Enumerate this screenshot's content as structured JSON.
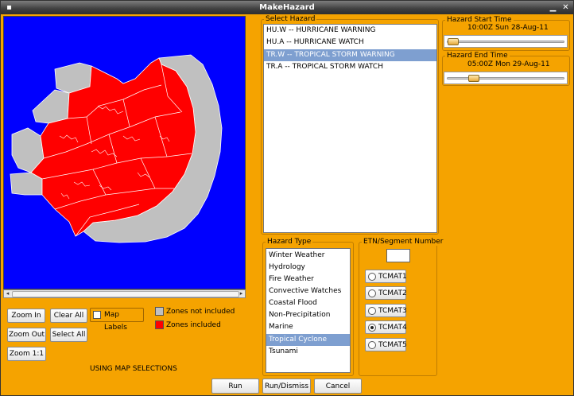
{
  "window": {
    "title": "MakeHazard"
  },
  "map": {
    "buttons": {
      "zoom_in": "Zoom In",
      "clear_all": "Clear All",
      "zoom_out": "Zoom Out",
      "select_all": "Select All",
      "zoom_1_1": "Zoom 1:1"
    },
    "map_labels": "Map Labels",
    "legend": {
      "not_included": "Zones not included",
      "included": "Zones included"
    },
    "status": "USING MAP SELECTIONS",
    "colors": {
      "water": "#0000ff",
      "included": "#ff0000",
      "not_included": "#c0c0c0"
    }
  },
  "select_hazard": {
    "title": "Select Hazard",
    "items": [
      "HU.W -- HURRICANE WARNING",
      "HU.A -- HURRICANE WATCH",
      "TR.W -- TROPICAL STORM WARNING",
      "TR.A -- TROPICAL STORM WATCH"
    ],
    "selected": "TR.W -- TROPICAL STORM WARNING"
  },
  "start_time": {
    "title": "Hazard Start Time",
    "value": "10:00Z Sun 28-Aug-11"
  },
  "end_time": {
    "title": "Hazard End Time",
    "value": "05:00Z Mon 29-Aug-11"
  },
  "hazard_type": {
    "title": "Hazard Type",
    "items": [
      "Winter Weather",
      "Hydrology",
      "Fire Weather",
      "Convective Watches",
      "Coastal Flood",
      "Non-Precipitation",
      "Marine",
      "Tropical Cyclone",
      "Tsunami"
    ],
    "selected": "Tropical Cyclone"
  },
  "etn": {
    "title": "ETN/Segment Number",
    "value": "",
    "options": [
      "TCMAT1",
      "TCMAT2",
      "TCMAT3",
      "TCMAT4",
      "TCMAT5"
    ],
    "selected": "TCMAT4"
  },
  "actions": {
    "run": "Run",
    "run_dismiss": "Run/Dismiss",
    "cancel": "Cancel"
  },
  "accent": "#f5a300"
}
